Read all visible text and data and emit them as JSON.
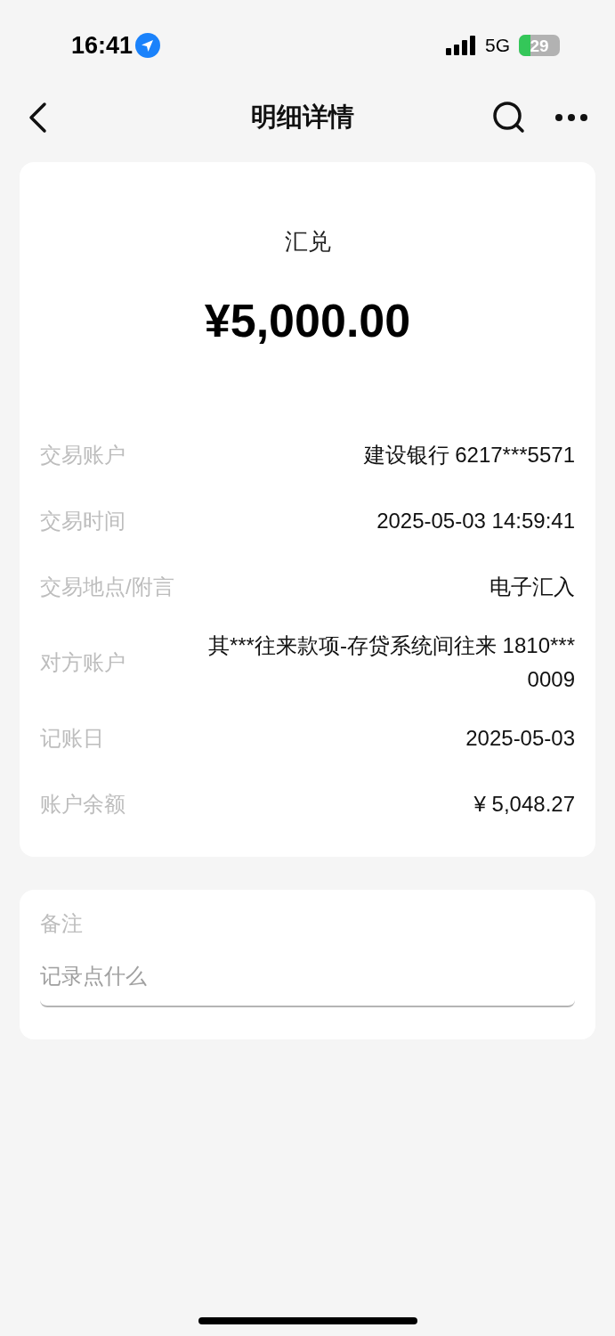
{
  "status_bar": {
    "time": "16:41",
    "network": "5G",
    "battery": "29"
  },
  "header": {
    "title": "明细详情"
  },
  "summary": {
    "type": "汇兑",
    "amount": "¥5,000.00"
  },
  "details": [
    {
      "label": "交易账户",
      "value": "建设银行 6217***5571"
    },
    {
      "label": "交易时间",
      "value": "2025-05-03 14:59:41"
    },
    {
      "label": "交易地点/附言",
      "value": "电子汇入"
    },
    {
      "label": "对方账户",
      "value": "其***往来款项-存贷系统间往来 1810***0009"
    },
    {
      "label": "记账日",
      "value": "2025-05-03"
    },
    {
      "label": "账户余额",
      "value": "¥ 5,048.27"
    }
  ],
  "note": {
    "label": "备注",
    "placeholder": "记录点什么"
  }
}
